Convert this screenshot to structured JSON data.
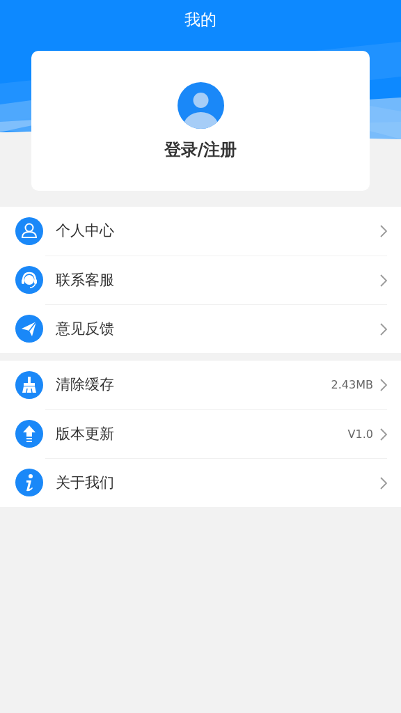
{
  "header": {
    "title": "我的"
  },
  "profile": {
    "login_label": "登录/注册"
  },
  "menu_groups": [
    {
      "items": [
        {
          "label": "个人中心"
        },
        {
          "label": "联系客服"
        },
        {
          "label": "意见反馈"
        }
      ]
    },
    {
      "items": [
        {
          "label": "清除缓存",
          "value": "2.43MB"
        },
        {
          "label": "版本更新",
          "value": "V1.0"
        },
        {
          "label": "关于我们"
        }
      ]
    }
  ]
}
